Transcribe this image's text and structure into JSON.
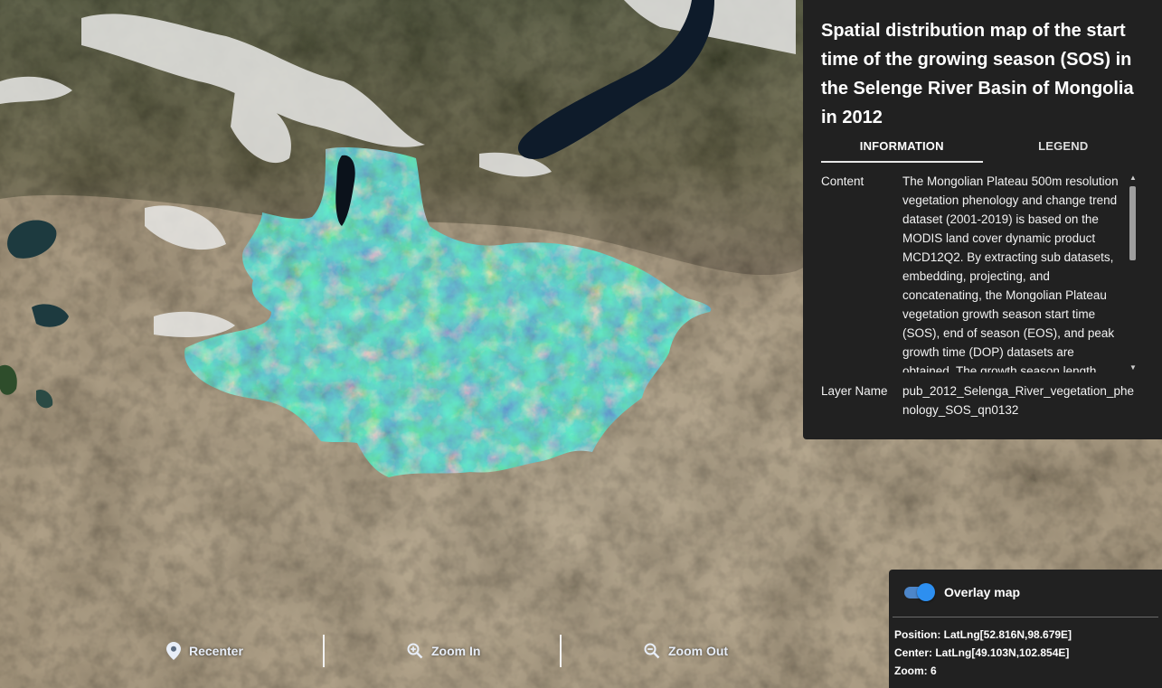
{
  "panel": {
    "title": "Spatial distribution map of the start time of the growing season (SOS) in the Selenge River Basin of Mongolia in 2012",
    "tabs": [
      "INFORMATION",
      "LEGEND"
    ],
    "active_tab": "INFORMATION",
    "content_label": "Content",
    "content_text": "The Mongolian Plateau 500m resolution vegetation phenology and change trend dataset (2001-2019) is based on the MODIS land cover dynamic product MCD12Q2. By extracting sub datasets, embedding, projecting, and concatenating, the Mongolian Plateau vegetation growth season start time (SOS), end of season (EOS), and peak growth time (DOP) datasets are obtained. The growth season length",
    "layer_label": "Layer Name",
    "layer_name": "pub_2012_Selenga_River_vegetation_phenology_SOS_qn0132"
  },
  "toolbar": {
    "recenter": "Recenter",
    "zoom_in": "Zoom In",
    "zoom_out": "Zoom Out"
  },
  "status": {
    "overlay_label": "Overlay map",
    "overlay_on": true,
    "position": "Position: LatLng[52.816N,98.679E]",
    "center": "Center: LatLng[49.103N,102.854E]",
    "zoom": "Zoom: 6"
  },
  "colors": {
    "panel_bg": "#212121",
    "toggle_knob": "#2d8ff0",
    "sos_early": "#f4e51d",
    "sos_mid": "#1fae82",
    "sos_late": "#2e3f8f"
  },
  "icons": {
    "recenter": "map-pin-icon",
    "zoom_in": "zoom-in-icon",
    "zoom_out": "zoom-out-icon"
  }
}
